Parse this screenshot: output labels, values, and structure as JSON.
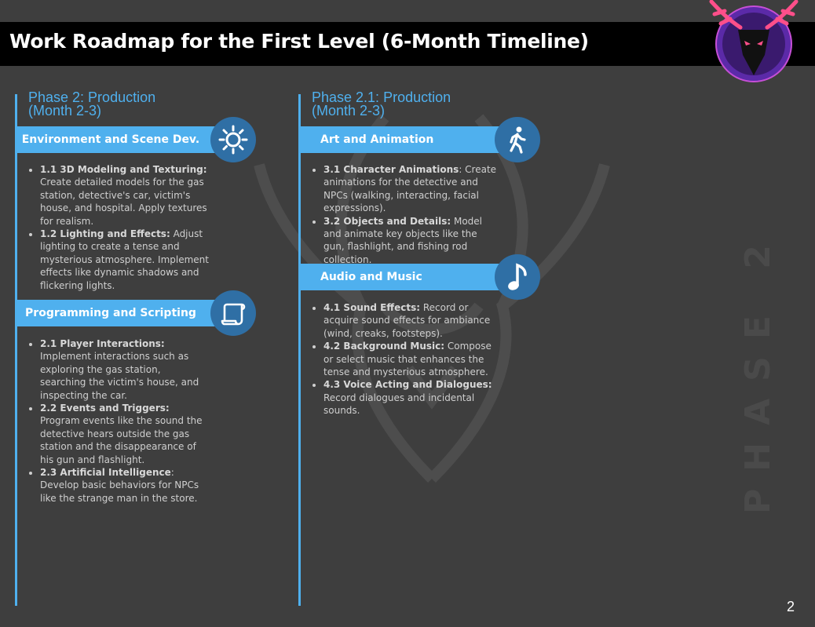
{
  "title": "Work Roadmap for the First Level (6-Month Timeline)",
  "page_number": "2",
  "watermark_text": "PHASE 2",
  "left_column": {
    "phase_line1": "Phase 2: Production",
    "phase_line2": "(Month 2-3)",
    "sections": [
      {
        "label": "Environment and Scene Dev.",
        "icon": "sun-icon",
        "items": [
          {
            "bold": "1.1 3D Modeling and Texturing:",
            "text": " Create detailed models for the gas station, detective's car, victim's house, and hospital. Apply textures for realism."
          },
          {
            "bold": "1.2 Lighting and Effects:",
            "text": " Adjust lighting to create a tense and mysterious atmosphere. Implement effects like dynamic shadows and flickering lights."
          }
        ]
      },
      {
        "label": "Programming and Scripting",
        "icon": "scroll-icon",
        "items": [
          {
            "bold": "2.1 Player Interactions:",
            "text": " Implement interactions such as exploring the gas station, searching the victim's house, and inspecting the car."
          },
          {
            "bold": "2.2 Events and Triggers:",
            "text": " Program events like the sound the detective hears outside the gas station and the disappearance of his gun and flashlight."
          },
          {
            "bold": "2.3 Artificial Intelligence",
            "text": ": Develop basic behaviors for NPCs like the strange man in the store."
          }
        ]
      }
    ]
  },
  "right_column": {
    "phase_line1": "Phase 2.1: Production",
    "phase_line2": "(Month 2-3)",
    "sections": [
      {
        "label": "Art and Animation",
        "icon": "walking-person-icon",
        "items": [
          {
            "bold": "3.1 Character Animations",
            "text": ": Create animations for the detective and NPCs (walking, interacting, facial expressions)."
          },
          {
            "bold": "3.2 Objects and Details:",
            "text": " Model and animate key objects like the gun, flashlight, and fishing rod collection."
          }
        ]
      },
      {
        "label": "Audio and Music",
        "icon": "music-note-icon",
        "items": [
          {
            "bold": "4.1 Sound Effects:",
            "text": " Record or acquire sound effects for ambiance (wind, creaks, footsteps)."
          },
          {
            "bold": "4.2 Background Music:",
            "text": " Compose or select music that enhances the tense and mysterious atmosphere."
          },
          {
            "bold": "4.3 Voice Acting and Dialogues:",
            "text": " Record dialogues and incidental sounds."
          }
        ]
      }
    ]
  },
  "colors": {
    "accent": "#4fb0ee",
    "icon_circle": "#2f6fa5",
    "background": "#3e3e3e",
    "title_bar": "#000000"
  }
}
